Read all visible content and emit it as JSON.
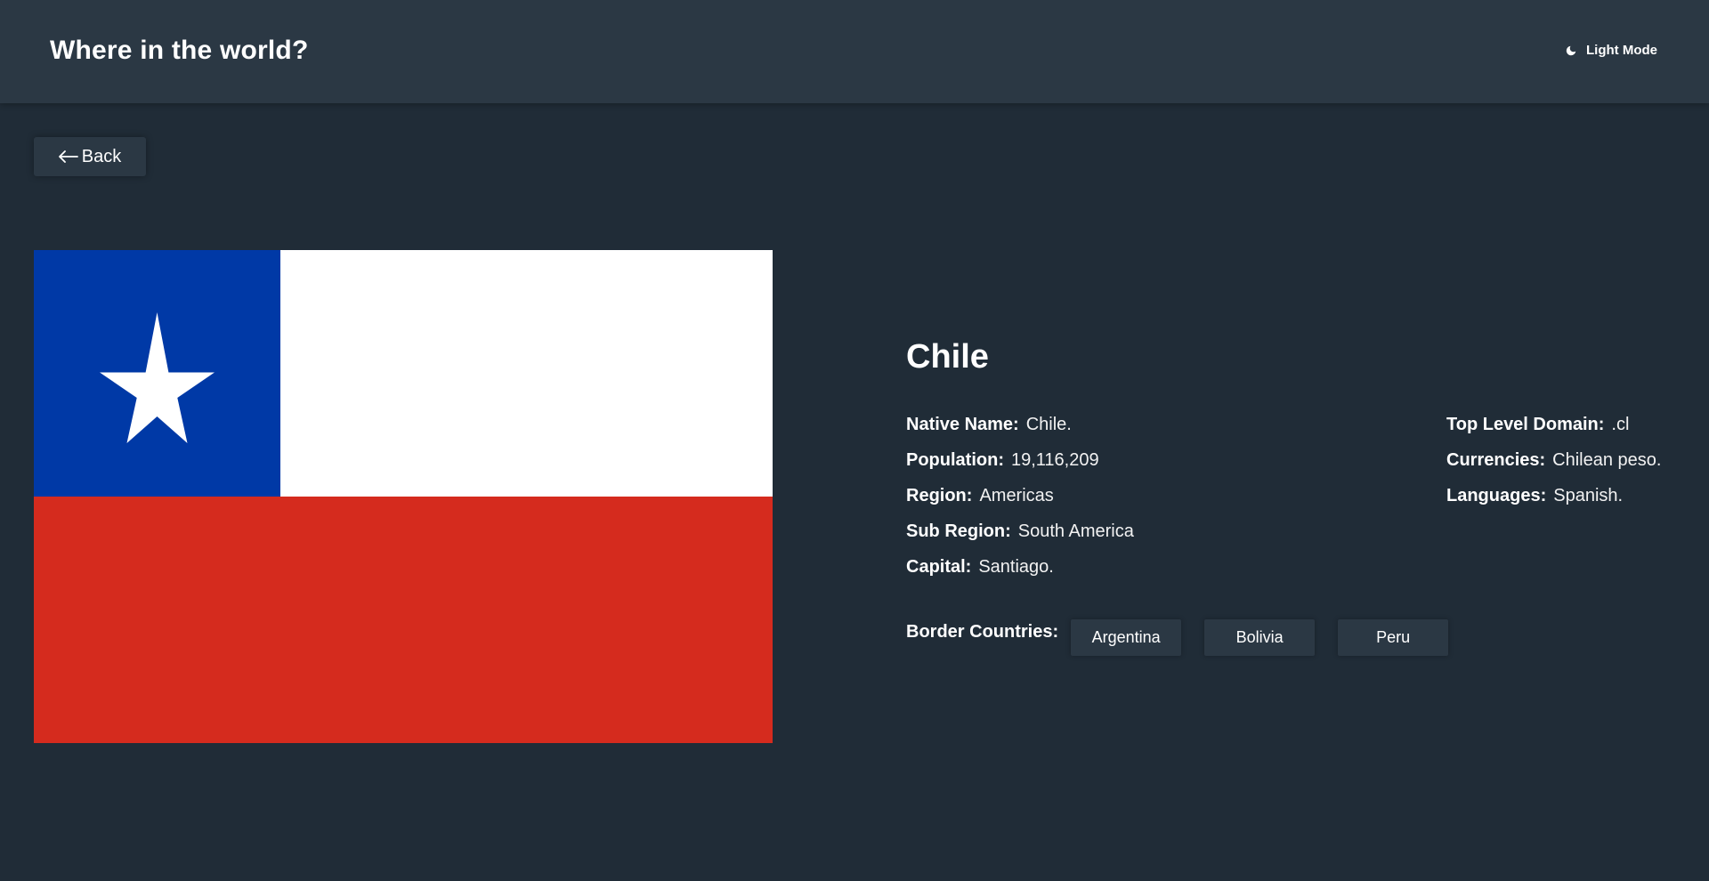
{
  "header": {
    "title": "Where in the world?",
    "mode_label": "Light Mode",
    "mode_icon": "moon-icon"
  },
  "back": {
    "label": "Back",
    "icon": "arrow-left-icon"
  },
  "flag": {
    "country": "Chile",
    "colors": {
      "blue": "#0039a6",
      "white": "#ffffff",
      "red": "#d52b1e"
    }
  },
  "country": {
    "name": "Chile",
    "left": [
      {
        "label": "Native Name:",
        "value": "Chile."
      },
      {
        "label": "Population:",
        "value": "19,116,209"
      },
      {
        "label": "Region:",
        "value": "Americas"
      },
      {
        "label": "Sub Region:",
        "value": "South America"
      },
      {
        "label": "Capital:",
        "value": "Santiago."
      }
    ],
    "right": [
      {
        "label": "Top Level Domain:",
        "value": ".cl"
      },
      {
        "label": "Currencies:",
        "value": "Chilean peso."
      },
      {
        "label": "Languages:",
        "value": "Spanish."
      }
    ],
    "borders_label": "Border Countries:",
    "borders": [
      "Argentina",
      "Bolivia",
      "Peru"
    ]
  },
  "theme": {
    "background": "#202c37",
    "element": "#2b3844",
    "text": "#ffffff"
  }
}
